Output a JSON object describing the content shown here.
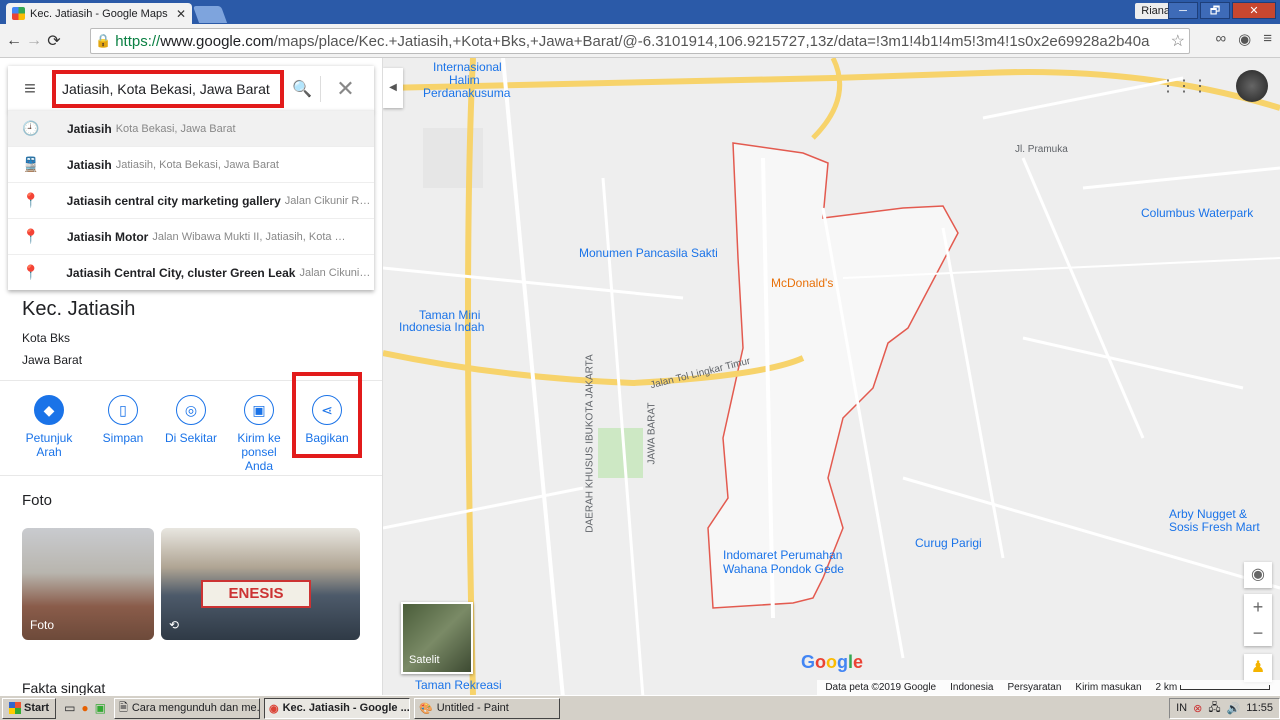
{
  "browser": {
    "tab_title": "Kec. Jatiasih - Google Maps",
    "tab_close": "✕",
    "user": "Riana",
    "url_https": "https://",
    "url_host": "www.google.com",
    "url_rest": "/maps/place/Kec.+Jatiasih,+Kota+Bks,+Jawa+Barat/@-6.3101914,106.9215727,13z/data=!3m1!4b1!4m5!3m4!1s0x2e69928a2b40a",
    "win_min": "─",
    "win_max": "🗗",
    "win_close": "✕"
  },
  "search": {
    "value": "Jatiasih, Kota Bekasi, Jawa Barat",
    "suggestions": [
      {
        "bold": "Jatiasih",
        "sub": "Kota Bekasi, Jawa Barat",
        "icon": "history-icon"
      },
      {
        "bold": "Jatiasih",
        "sub": "Jatiasih, Kota Bekasi, Jawa Barat",
        "icon": "train-icon"
      },
      {
        "bold": "Jatiasih central city marketing gallery",
        "sub": "Jalan Cikunir Ra...",
        "icon": "pin-icon"
      },
      {
        "bold": "Jatiasih Motor",
        "sub": "Jalan Wibawa Mukti II, Jatiasih, Kota Bek...",
        "icon": "pin-icon"
      },
      {
        "bold": "Jatiasih Central City, cluster Green Leak",
        "sub": "Jalan Cikunir ...",
        "icon": "pin-icon"
      }
    ]
  },
  "place": {
    "name": "Kec. Jatiasih",
    "city": "Kota Bks",
    "province": "Jawa Barat"
  },
  "actions": [
    {
      "label1": "Petunjuk",
      "label2": "Arah",
      "icon": "directions-icon"
    },
    {
      "label1": "Simpan",
      "label2": "",
      "icon": "bookmark-icon"
    },
    {
      "label1": "Di Sekitar",
      "label2": "",
      "icon": "nearby-icon"
    },
    {
      "label1": "Kirim ke",
      "label2": "ponsel Anda",
      "icon": "send-to-phone-icon"
    },
    {
      "label1": "Bagikan",
      "label2": "",
      "icon": "share-icon"
    }
  ],
  "photos": {
    "heading": "Foto",
    "photo1_label": "Foto",
    "banner_text": "ENESIS"
  },
  "fakta": "Fakta singkat",
  "map": {
    "labels": {
      "halim1": "Internasional",
      "halim2": "Halim",
      "halim3": "Perdanakusuma",
      "monumen": "Monumen Pancasila Sakti",
      "tmii1": "Taman Mini",
      "tmii2": "Indonesia Indah",
      "mcd": "McDonald's",
      "columbus": "Columbus Waterpark",
      "arby1": "Arby Nugget &",
      "arby2": "Sosis Fresh Mart",
      "curug": "Curug Parigi",
      "indo1": "Indomaret Perumahan",
      "indo2": "Wahana Pondok Gede",
      "rekreasi": "Taman Rekreasi",
      "tol": "Jalan Tol Lingkar Timur",
      "jakarta": "DAERAH KHUSUS IBUKOTA JAKARTA",
      "jabar": "JAWA BARAT",
      "pramuka": "Jl. Pramuka",
      "sat": "Satelit"
    },
    "logo": "Google",
    "footer": {
      "data": "Data peta ©2019 Google",
      "country": "Indonesia",
      "terms": "Persyaratan",
      "feedback": "Kirim masukan",
      "scale": "2 km"
    }
  },
  "taskbar": {
    "start": "Start",
    "tasks": [
      {
        "label": "Cara mengunduh dan me...",
        "active": false
      },
      {
        "label": "Kec. Jatiasih - Google ...",
        "active": true
      },
      {
        "label": "Untitled - Paint",
        "active": false
      }
    ],
    "lang": "IN",
    "time": "11:55"
  },
  "colors": {
    "accent": "#1a73e8",
    "highlight": "#e21b1b",
    "boundary": "#e35a4f"
  }
}
